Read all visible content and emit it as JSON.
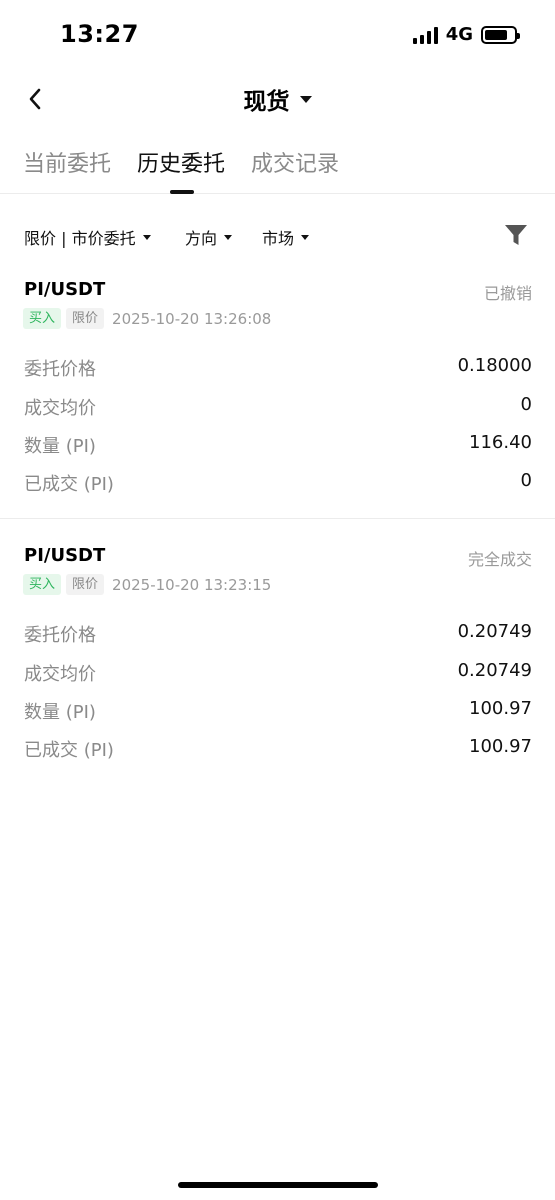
{
  "status_bar": {
    "time": "13:27",
    "network": "4G"
  },
  "nav": {
    "title": "现货"
  },
  "tabs": [
    {
      "label": "当前委托",
      "active": false
    },
    {
      "label": "历史委托",
      "active": true
    },
    {
      "label": "成交记录",
      "active": false
    }
  ],
  "filters": {
    "order_type": "限价 | 市价委托",
    "direction": "方向",
    "market": "市场"
  },
  "orders": [
    {
      "pair": "PI/USDT",
      "status": "已撤销",
      "side_tag": "买入",
      "type_tag": "限价",
      "time": "2025-10-20 13:26:08",
      "rows": [
        {
          "label": "委托价格",
          "value": "0.18000"
        },
        {
          "label": "成交均价",
          "value": "0"
        },
        {
          "label": "数量 (PI)",
          "value": "116.40"
        },
        {
          "label": "已成交 (PI)",
          "value": "0"
        }
      ]
    },
    {
      "pair": "PI/USDT",
      "status": "完全成交",
      "side_tag": "买入",
      "type_tag": "限价",
      "time": "2025-10-20 13:23:15",
      "rows": [
        {
          "label": "委托价格",
          "value": "0.20749"
        },
        {
          "label": "成交均价",
          "value": "0.20749"
        },
        {
          "label": "数量 (PI)",
          "value": "100.97"
        },
        {
          "label": "已成交 (PI)",
          "value": "100.97"
        }
      ]
    }
  ],
  "colors": {
    "buy": "#2db55d",
    "buy_bg": "#e6f7eb",
    "muted": "#8a8a8a"
  },
  "icons": {
    "back": "chevron-left-icon",
    "filter": "funnel-icon"
  }
}
